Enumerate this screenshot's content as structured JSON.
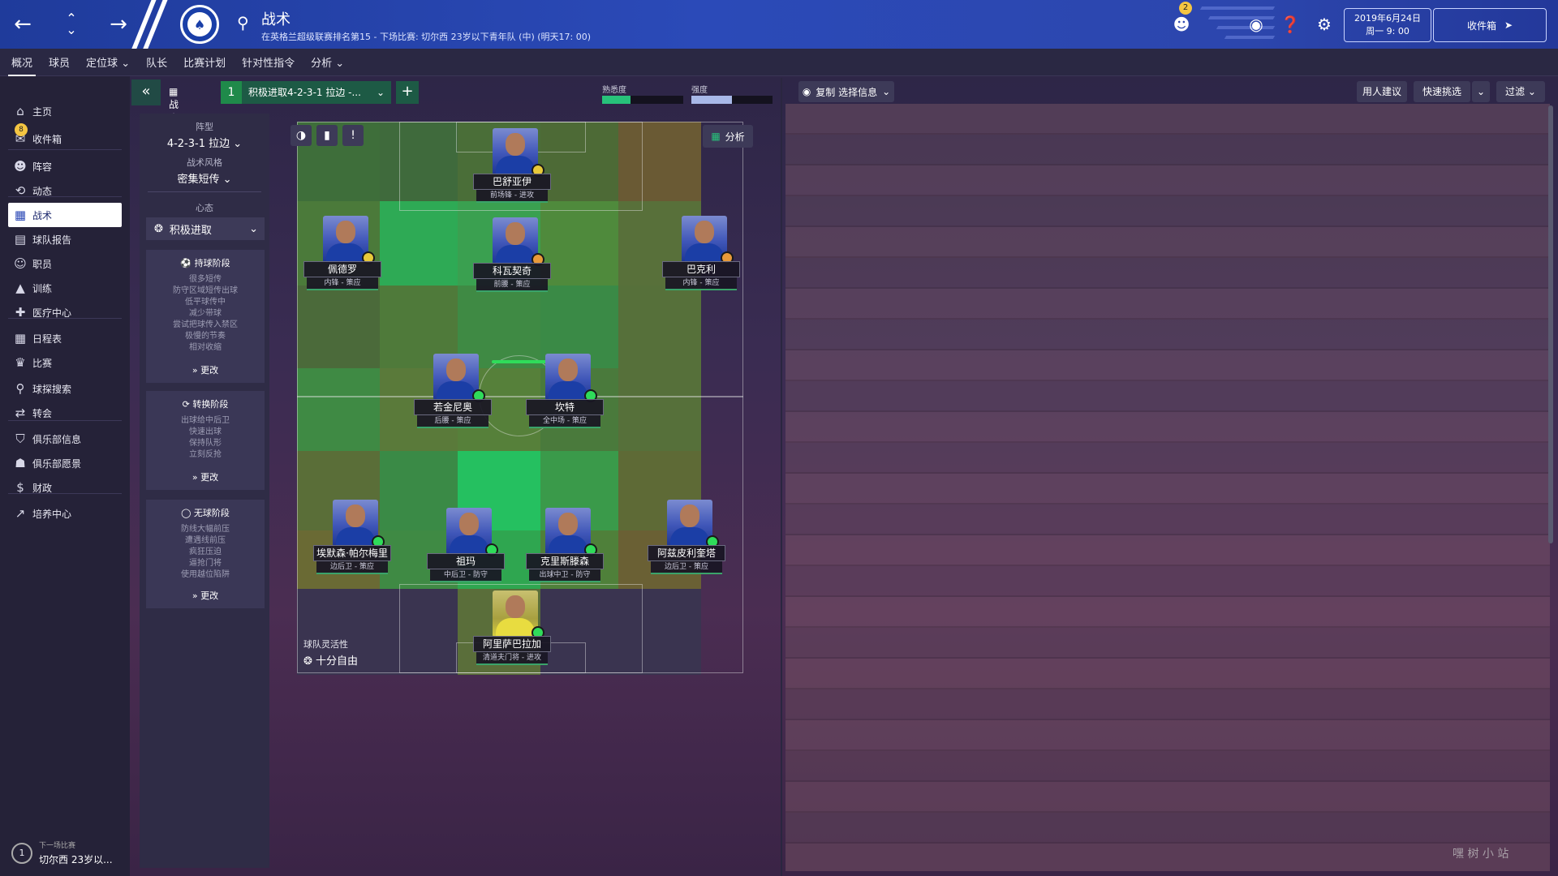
{
  "header": {
    "title": "战术",
    "subtitle": "在英格兰超级联赛排名第15 - 下场比赛: 切尔西 23岁以下青年队 (中) (明天17: 00)",
    "notification_count": "2",
    "date_line1": "2019年6月24日",
    "date_line2": "周一 9: 00",
    "inbox_label": "收件箱"
  },
  "tabs": [
    "概况",
    "球员",
    "定位球",
    "队长",
    "比赛计划",
    "针对性指令",
    "分析"
  ],
  "sidebar": {
    "inbox_badge": "8",
    "items": [
      {
        "label": "主页",
        "icon": "home-icon"
      },
      {
        "label": "收件箱",
        "icon": "inbox-icon"
      },
      {
        "label": "阵容",
        "icon": "squad-icon"
      },
      {
        "label": "动态",
        "icon": "dynamics-icon"
      },
      {
        "label": "战术",
        "icon": "tactics-icon"
      },
      {
        "label": "球队报告",
        "icon": "report-icon"
      },
      {
        "label": "职员",
        "icon": "staff-icon"
      },
      {
        "label": "训练",
        "icon": "training-icon"
      },
      {
        "label": "医疗中心",
        "icon": "medical-icon"
      },
      {
        "label": "日程表",
        "icon": "calendar-icon"
      },
      {
        "label": "比赛",
        "icon": "trophy-icon"
      },
      {
        "label": "球探搜索",
        "icon": "scouting-icon"
      },
      {
        "label": "转会",
        "icon": "transfer-icon"
      },
      {
        "label": "俱乐部信息",
        "icon": "club-info-icon"
      },
      {
        "label": "俱乐部愿景",
        "icon": "vision-icon"
      },
      {
        "label": "财政",
        "icon": "finance-icon"
      },
      {
        "label": "培养中心",
        "icon": "development-icon"
      }
    ],
    "next_match_label": "下一场比赛",
    "next_match_value": "切尔西 23岁以...",
    "next_match_num": "1"
  },
  "tactic_bar": {
    "label": "战术",
    "number": "1",
    "name": "积极进取4-2-3-1 拉边 -...",
    "familiarity_label": "熟悉度",
    "strength_label": "强度",
    "familiarity_value": 0.35,
    "strength_value": 0.5
  },
  "tactic_panel": {
    "formation_label": "阵型",
    "formation_value": "4-2-3-1 拉边",
    "style_label": "战术风格",
    "style_value": "密集短传",
    "mentality_label": "心态",
    "mentality_value": "积极进取",
    "phases": [
      {
        "title": "持球阶段",
        "lines": [
          "很多短传",
          "防守区域短传出球",
          "低平球传中",
          "减少带球",
          "尝试把球传入禁区",
          "极慢的节奏",
          "相对收缩"
        ],
        "change": "更改"
      },
      {
        "title": "转换阶段",
        "lines": [
          "出球给中后卫",
          "快速出球",
          "保持队形",
          "立刻反抢"
        ],
        "change": "更改"
      },
      {
        "title": "无球阶段",
        "lines": [
          "防线大幅前压",
          "遭遇线前压",
          "疯狂压迫",
          "逼抢门将",
          "使用越位陷阱"
        ],
        "change": "更改"
      }
    ]
  },
  "pitch": {
    "analysis_label": "分析",
    "fluidity_label": "球队灵活性",
    "fluidity_value": "十分自由",
    "players": [
      {
        "name": "巴舒亚伊",
        "role": "前场锋 - 进攻",
        "status_color": "#e8c93a"
      },
      {
        "name": "佩德罗",
        "role": "内锋 - 策应",
        "status_color": "#e8c93a"
      },
      {
        "name": "科瓦契奇",
        "role": "前腰 - 策应",
        "status_color": "#e89a3a"
      },
      {
        "name": "巴克利",
        "role": "内锋 - 策应",
        "status_color": "#e89a3a"
      },
      {
        "name": "若金尼奥",
        "role": "后腰 - 策应",
        "status_color": "#2fdc5a"
      },
      {
        "name": "坎特",
        "role": "全中场 - 策应",
        "status_color": "#2fdc5a"
      },
      {
        "name": "埃默森·帕尔梅里",
        "role": "边后卫 - 策应",
        "status_color": "#2fdc5a"
      },
      {
        "name": "祖玛",
        "role": "中后卫 - 防守",
        "status_color": "#2fdc5a"
      },
      {
        "name": "克里斯滕森",
        "role": "出球中卫 - 防守",
        "status_color": "#2fdc5a"
      },
      {
        "name": "阿兹皮利奎塔",
        "role": "边后卫 - 策应",
        "status_color": "#2fdc5a"
      },
      {
        "name": "阿里萨巴拉加",
        "role": "清道夫门将 - 进攻",
        "status_color": "#2fdc5a"
      }
    ]
  },
  "right_toolbar": {
    "copy_label": "复制 选择信息",
    "recommend_label": "用人建议",
    "quick_pick_label": "快速挑选",
    "filter_label": "过滤"
  },
  "watermark": "嘿 树 小 站"
}
